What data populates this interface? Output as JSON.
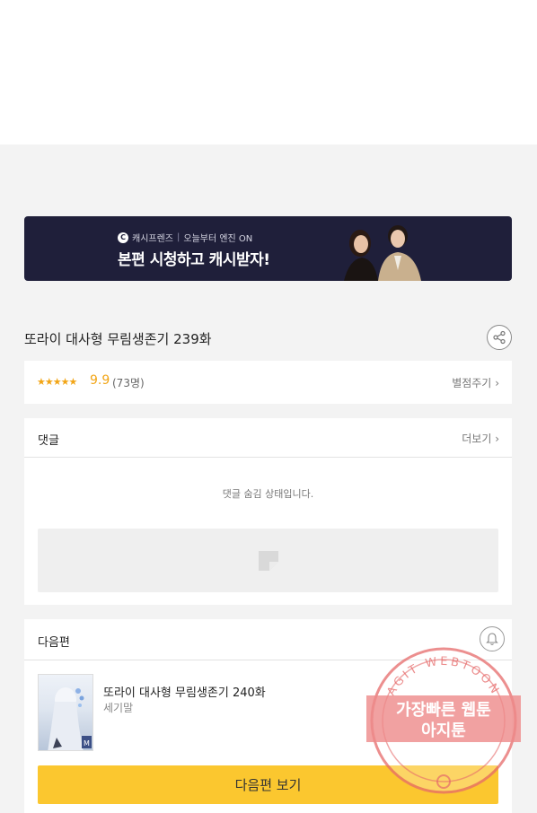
{
  "banner": {
    "brand": "캐시프렌즈",
    "tagline": "오늘부터 엔진 ON",
    "headline": "본편 시청하고 캐시받자!"
  },
  "episode": {
    "title": "또라이 대사형 무림생존기 239화",
    "share_icon": "share-icon"
  },
  "rating": {
    "stars": "★★★★★",
    "score": "9.9",
    "count": "(73명)",
    "rate_link": "별점주기",
    "colors": {
      "accent": "#f2a516"
    }
  },
  "comments": {
    "title": "댓글",
    "more_link": "더보기",
    "hidden_message": "댓글 숨김 상태입니다."
  },
  "next": {
    "section_title": "다음편",
    "bell_icon": "bell-icon",
    "ep_title": "또라이 대사형 무림생존기 240화",
    "author": "세기말",
    "button_label": "다음편 보기",
    "colors": {
      "button": "#fbc72f"
    }
  },
  "watermark": {
    "ring_text": "AGIT WEBTOON",
    "line1": "가장빠른 웹툰",
    "line2": "아지툰"
  }
}
